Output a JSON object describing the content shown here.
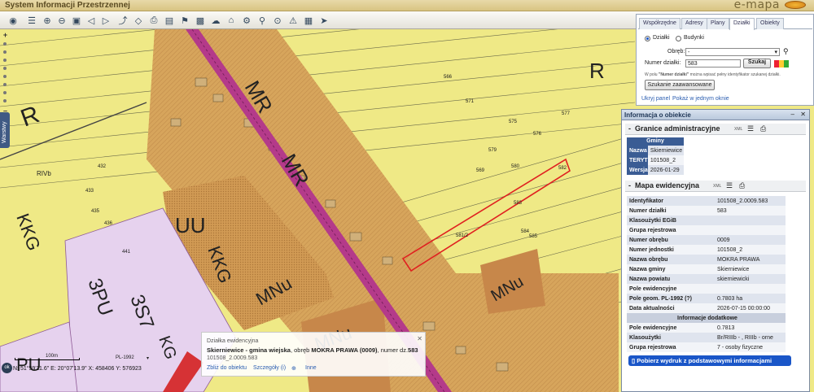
{
  "header": {
    "title": "System Informacji Przestrzennej",
    "brand": "e-mapa"
  },
  "toolbar": {
    "icons": [
      "logo-icon",
      "layers-icon",
      "zoom-in-icon",
      "zoom-out-icon",
      "zoom-extent-icon",
      "zoom-prev-icon",
      "zoom-next-icon",
      "measure-line-icon",
      "measure-area-icon",
      "print-icon",
      "folder-icon",
      "pin-icon",
      "save-icon",
      "cloud-icon",
      "home-icon",
      "settings-icon",
      "search-map-icon",
      "search-parcel-icon",
      "warning-icon",
      "legend-icon",
      "arrow-icon"
    ]
  },
  "search": {
    "tabs": [
      "Współrzędne",
      "Adresy",
      "Plany",
      "Działki",
      "Obiekty"
    ],
    "active_tab": "Działki",
    "radio1": "Działki",
    "radio2": "Budynki",
    "obreb_label": "Obręb:",
    "obreb_value": "-",
    "numer_label": "Numer działki:",
    "numer_value": "583",
    "search_button": "Szukaj",
    "hint_prefix": "W polu ",
    "hint_bold": "\"Numer działki\"",
    "hint_suffix": " można wpisać pełny identyfikator szukanej działki.",
    "advanced_button": "Szukanie zaawansowane",
    "hide_panel": "Ukryj panel",
    "show_one_window": "Pokaż w jednym oknie"
  },
  "info": {
    "title": "Informacja o obiekcie",
    "admin": {
      "heading": "Granice administracyjne",
      "xml": "XML",
      "table_title": "Gminy",
      "rows": [
        {
          "k": "Nazwa",
          "v": "Skierniewice"
        },
        {
          "k": "TERYT",
          "v": "101508_2"
        },
        {
          "k": "Wersja",
          "v": "2026-01-29"
        }
      ]
    },
    "ewid": {
      "heading": "Mapa ewidencyjna",
      "xml": "XML",
      "rows": [
        {
          "k": "Identyfikator",
          "v": "101508_2.0009.583"
        },
        {
          "k": "Numer działki",
          "v": "583"
        },
        {
          "k": "Klasoużytki EGiB",
          "v": ""
        },
        {
          "k": "Grupa rejestrowa",
          "v": ""
        },
        {
          "k": "Numer obrębu",
          "v": "0009"
        },
        {
          "k": "Numer jednostki",
          "v": "101508_2"
        },
        {
          "k": "Nazwa obrębu",
          "v": "MOKRA PRAWA"
        },
        {
          "k": "Nazwa gminy",
          "v": "Skierniewice"
        },
        {
          "k": "Nazwa powiatu",
          "v": "skierniewicki"
        },
        {
          "k": "Pole ewidencyjne",
          "v": ""
        },
        {
          "k": "Pole geom. PL-1992 (?)",
          "v": "0.7803 ha"
        },
        {
          "k": "Data aktualności",
          "v": "2026-07-15 00:00:00"
        }
      ],
      "sub_heading": "Informacje dodatkowe",
      "rows2": [
        {
          "k": "Pole ewidencyjne",
          "v": "0.7813"
        },
        {
          "k": "Klasoużytki",
          "v": "Br/RIIIb - , RIIIb - orne"
        },
        {
          "k": "Grupa rejestrowa",
          "v": "7 - osoby fizyczne"
        }
      ],
      "print_button": "Pobierz wydruk z podstawowymi informacjami"
    }
  },
  "popup": {
    "title": "Działka ewidencyjna",
    "line1_a": "Skierniewice - gmina wiejska",
    "line1_b": ", obręb ",
    "line1_c": "MOKRA PRAWA (0009)",
    "line1_d": ", numer dz.",
    "line1_e": "583",
    "line2": "101508_2.0009.583",
    "link1": "Zbliż do obiektu",
    "link2": "Szczegóły (i)",
    "link3": "Inne"
  },
  "map": {
    "scale_label": "100m",
    "crs": "PL-1992",
    "coords": "N: 51°59'11.6\"  E: 20°07'13.9\"  X: 458406    Y: 576923",
    "layers_tab": "Warstwy",
    "ok": "ok",
    "zone_labels": [
      "R",
      "R",
      "R",
      "KKG",
      "MR",
      "MR",
      "UU",
      "MNu",
      "MNu",
      "MNu",
      "KKG",
      "3PU",
      "3S7",
      "PU",
      "KG",
      "R",
      "RIVb"
    ],
    "parcel_labels": [
      "583",
      "582",
      "584",
      "585",
      "581/2",
      "580",
      "579",
      "571",
      "575",
      "576",
      "577",
      "566",
      "441",
      "432",
      "433",
      "435",
      "436",
      "569"
    ]
  },
  "colors": {
    "field": "#efe986",
    "residential": "#d7a55c",
    "residential_dark": "#b67a3c",
    "industrial": "#e6d2ee",
    "road": "#b43a8a",
    "selection": "#e02020",
    "panel_header": "#b9c8dc",
    "accent_blue": "#1a56c8"
  }
}
